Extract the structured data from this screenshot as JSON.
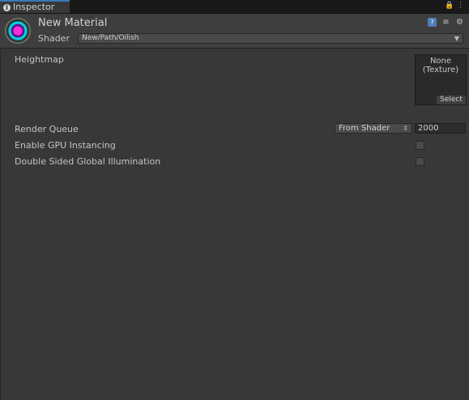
{
  "tab": {
    "title": "Inspector",
    "icon": "info-icon"
  },
  "tab_icons": [
    "lock-icon",
    "menu-icon"
  ],
  "header": {
    "material_name": "New Material",
    "shader_label": "Shader",
    "shader_value": "New/Path/Oilish",
    "icons": [
      "help-icon",
      "settings-sliders-icon",
      "gear-icon"
    ]
  },
  "properties": {
    "heightmap": {
      "label": "Heightmap",
      "texture_value": "None\n(Texture)",
      "select_label": "Select"
    },
    "render_queue": {
      "label": "Render Queue",
      "mode": "From Shader",
      "value": "2000"
    },
    "gpu_instancing": {
      "label": "Enable GPU Instancing",
      "checked": false
    },
    "double_sided_gi": {
      "label": "Double Sided Global Illumination",
      "checked": false
    }
  },
  "colors": {
    "accent": "#3a79bb",
    "panel_bg": "#383838",
    "header_bg": "#3e3e3e"
  }
}
